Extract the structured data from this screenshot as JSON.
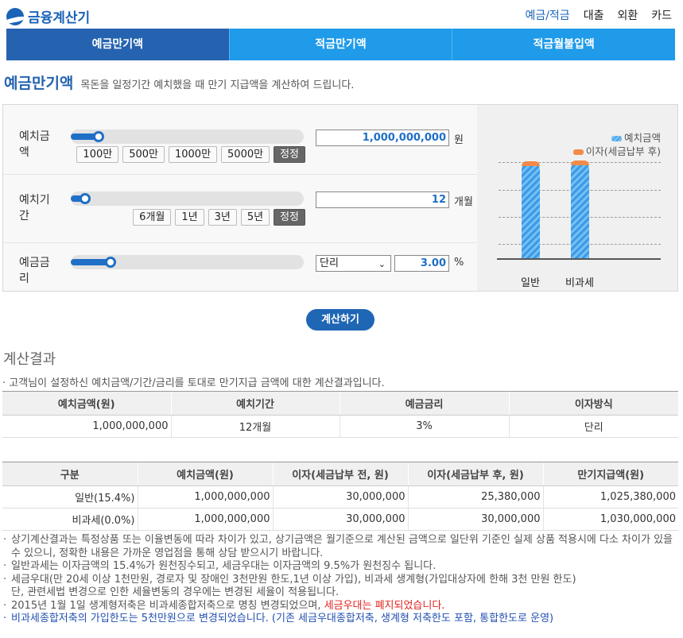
{
  "header": {
    "logo": "금융계산기",
    "nav": [
      "예금/적금",
      "대출",
      "외환",
      "카드"
    ]
  },
  "tabs": [
    "예금만기액",
    "적금만기액",
    "적금월불입액"
  ],
  "title": {
    "main": "예금만기액",
    "sub": "목돈을 일정기간 예치했을 때 만기 지급액을 계산하여 드립니다."
  },
  "form": {
    "deposit": {
      "label": "예치금액",
      "slider": 0.12,
      "buttons": [
        "100만",
        "500만",
        "1000만",
        "5000만"
      ],
      "reset": "정정",
      "value": "1,000,000,000",
      "unit": "원"
    },
    "period": {
      "label": "예치기간",
      "slider": 0.06,
      "buttons": [
        "6개월",
        "1년",
        "3년",
        "5년"
      ],
      "reset": "정정",
      "value": "12",
      "unit": "개월"
    },
    "rate": {
      "label": "예금금리",
      "slider": 0.17,
      "select": "단리",
      "value": "3.00",
      "unit": "%"
    }
  },
  "chart_data": {
    "type": "bar",
    "categories": [
      "일반",
      "비과세"
    ],
    "series": [
      {
        "name": "예치금액",
        "values": [
          1000000000,
          1000000000
        ],
        "color": "#3b9be8"
      },
      {
        "name": "이자(세금납부 후)",
        "values": [
          25380000,
          30000000
        ],
        "color": "#f28a4a"
      }
    ],
    "stacked": true,
    "grid": true,
    "legend": "top-right"
  },
  "calc_button": "계산하기",
  "result": {
    "title": "계산결과",
    "desc": "고객님이 설정하신 예치금액/기간/금리를 토대로 만기지급 금액에 대한 계산결과입니다.",
    "summary": {
      "headers": [
        "예치금액(원)",
        "예치기간",
        "예금금리",
        "이자방식"
      ],
      "row": [
        "1,000,000,000",
        "12개월",
        "3%",
        "단리"
      ]
    },
    "detail": {
      "headers": [
        "구분",
        "예치금액(원)",
        "이자(세금납부 전, 원)",
        "이자(세금납부 후, 원)",
        "만기지급액(원)"
      ],
      "rows": [
        [
          "일반(15.4%)",
          "1,000,000,000",
          "30,000,000",
          "25,380,000",
          "1,025,380,000"
        ],
        [
          "비과세(0.0%)",
          "1,000,000,000",
          "30,000,000",
          "30,000,000",
          "1,030,000,000"
        ]
      ]
    }
  },
  "notes": {
    "n1": "상기계산결과는 특정상품 또는 이율변동에 따라 차이가 있고, 상기금액은 월기준으로 계산된 금액으로 일단위 기준인 실제 상품 적용시에 다소 차이가 있을 수 있으니, 정확한 내용은 가까운 영업점을 통해 상담 받으시기 바랍니다.",
    "n2": "일반과세는 이자금액의 15.4%가 원천징수되고, 세금우대는 이자금액의 9.5%가 원천징수 됩니다.",
    "n3a": "세금우대(만 20세 이상 1천만원, 경로자 및 장애인 3천만원 한도,1년 이상 가입), 비과세 생계형(가입대상자에 한해 3천 만원 한도)",
    "n3b": "단, 관련세법 변경으로 인한 세율변동의 경우에는 변경된 세율이 적용됩니다.",
    "n4a": "2015년 1월 1일 생계형저축은 비과세종합저축으로 명칭 변경되었으며, ",
    "n4b": "세금우대는 폐지되었습니다.",
    "n5": "비과세종합저축의 가입한도는 5천만원으로 변경되었습니다. (기존 세금우대종합저축, 생계형 저축한도 포함, 통합한도로 운영)"
  }
}
